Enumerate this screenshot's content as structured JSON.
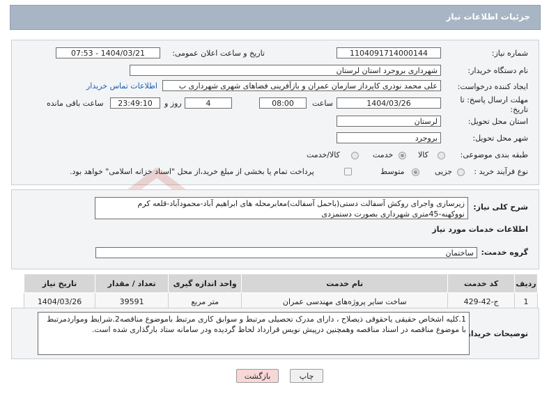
{
  "page": {
    "title": "جزئیات اطلاعات نیاز"
  },
  "fields": {
    "need_number_label": "شماره نیاز:",
    "need_number": "1104091714000144",
    "announce_label": "تاریخ و ساعت اعلان عمومی:",
    "announce_value": "1404/03/21 - 07:53",
    "buyer_org_label": "نام دستگاه خریدار:",
    "buyer_org": "شهرداری بروجرد استان لرستان",
    "creator_label": "ایجاد کننده درخواست:",
    "creator": "علی محمد نوذری کاپرداز سازمان عمران و بازآفرینی فضاهای شهری شهرداری ب",
    "contact_link": "اطلاعات تماس خریدار",
    "deadline_label_1": "مهلت ارسال پاسخ: تا",
    "deadline_label_2": "تاریخ:",
    "deadline_date": "1404/03/26",
    "time_label": "ساعت",
    "deadline_time": "08:00",
    "days_value": "4",
    "days_label": "روز و",
    "remaining_time": "23:49:10",
    "remaining_label": "ساعت باقی مانده",
    "province_label": "استان محل تحویل:",
    "province": "لرستان",
    "city_label": "شهر محل تحویل:",
    "city": "بروجرد",
    "category_label": "طبقه بندی موضوعی:",
    "category_options": [
      "کالا",
      "خدمت",
      "کالا/خدمت"
    ],
    "category_selected": "خدمت",
    "process_label": "نوع فرآیند خرید :",
    "process_options": [
      "جزیی",
      "متوسط"
    ],
    "process_selected": "متوسط",
    "payment_note": "پرداخت تمام یا بخشی از مبلغ خرید،از محل \"اسناد خزانه اسلامی\" خواهد بود."
  },
  "description": {
    "label": "شرح کلی نیاز:",
    "text": "زیرسازی واجرای روکش آسفالت دستی(باحمل آسفالت)معابرمحله های ابراهیم آباد-محمودآباد-قلعه کرم نووکهنه-45متری شهرداری بصورت دستمزدی"
  },
  "services": {
    "section_title": "اطلاعات خدمات مورد نیاز",
    "group_label": "گروه خدمت:",
    "group_value": "ساختمان",
    "columns": [
      "ردیف",
      "کد خدمت",
      "نام خدمت",
      "واحد اندازه گیری",
      "تعداد / مقدار",
      "تاریخ نیاز"
    ],
    "rows": [
      {
        "row": "1",
        "code": "ج-42-429",
        "name": "ساخت سایر پروژه‌های مهندسی عمران",
        "unit": "متر مربع",
        "qty": "39591",
        "date": "1404/03/26"
      }
    ]
  },
  "buyer_notes": {
    "label": "توضیحات خریدار:",
    "text": "1.کلیه اشخاص حقیقی یاحقوقی ذیصلاح ، دارای مدرک تحصیلی مرتبط و سوابق کاری مرتبط باموضوع مناقصه2.شرایط ومواردمرتبط با موضوع مناقصه در اسناد مناقصه وهمچنین درپیش نویس قرارداد لحاظ گردیده ودر سامانه ستاد بارگذاری شده است."
  },
  "buttons": {
    "print": "چاپ",
    "back": "بازگشت"
  },
  "colors": {
    "header": "#a8b5c4",
    "back_button": "#f8d7d7",
    "link": "#1a5fb4"
  }
}
